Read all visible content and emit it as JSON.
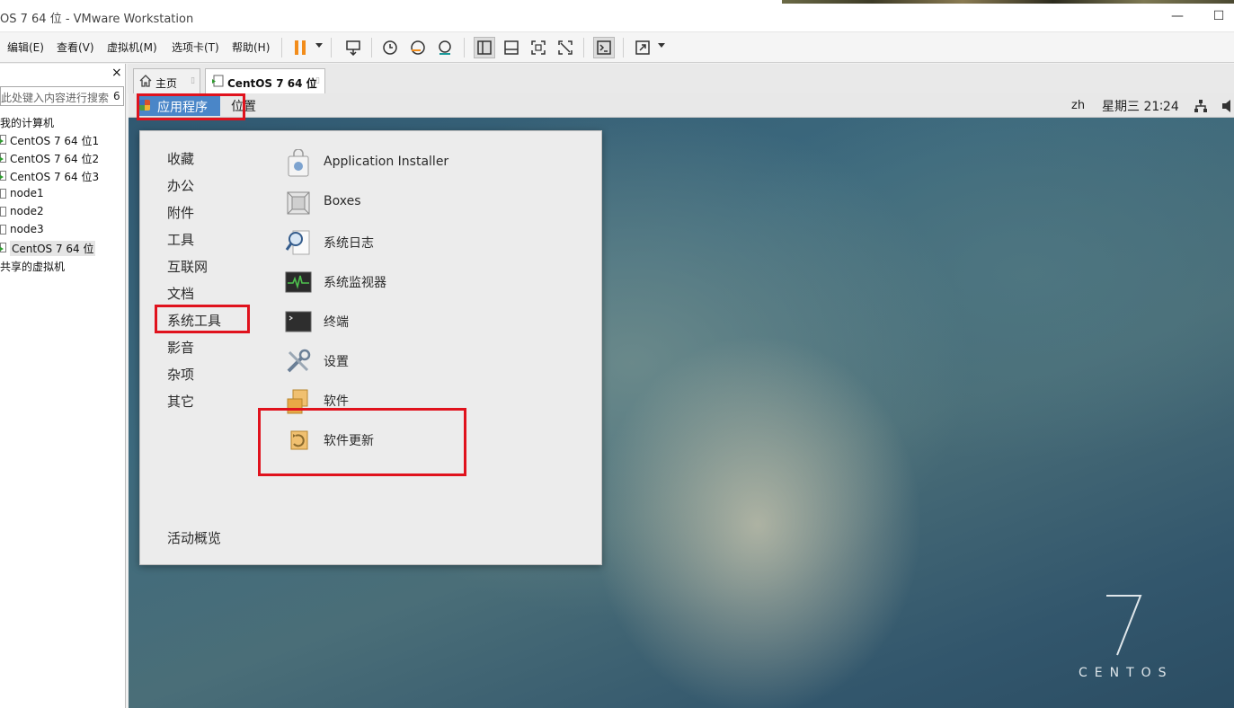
{
  "window": {
    "title": "OS 7 64 位 - VMware Workstation",
    "minimize_glyph": "—",
    "maximize_glyph": "☐"
  },
  "menubar": {
    "items": [
      "编辑(E)",
      "查看(V)",
      "虚拟机(M)",
      "选项卡(T)",
      "帮助(H)"
    ]
  },
  "toolbar": {
    "icons": [
      "pause-icon",
      "send-ctrl-alt-del-icon",
      "snapshot-icon",
      "revert-snapshot-icon",
      "snapshot-manager-icon",
      "show-library-icon",
      "thumbnail-bar-icon",
      "full-screen-icon",
      "unity-icon",
      "console-view-icon",
      "stretch-view-icon"
    ],
    "accent_color": "#f28c1a"
  },
  "sidebar": {
    "close_glyph": "×",
    "search_placeholder": "此处键入内容进行搜索",
    "search_caret": "6",
    "tree": [
      {
        "label": "我的计算机",
        "level": 0
      },
      {
        "label": "CentOS 7 64 位1",
        "level": 1,
        "running": true
      },
      {
        "label": "CentOS 7 64 位2",
        "level": 1,
        "running": true
      },
      {
        "label": "CentOS 7 64 位3",
        "level": 1,
        "running": true
      },
      {
        "label": "node1",
        "level": 1,
        "running": false
      },
      {
        "label": "node2",
        "level": 1,
        "running": false
      },
      {
        "label": "node3",
        "level": 1,
        "running": false
      },
      {
        "label": "CentOS 7 64 位",
        "level": 1,
        "running": true,
        "selected": true
      },
      {
        "label": "共享的虚拟机",
        "level": 0
      }
    ]
  },
  "tabs": [
    {
      "label": "主页",
      "icon": "home-icon",
      "active": false
    },
    {
      "label": "CentOS 7 64 位",
      "icon": "vm-running-icon",
      "active": true
    }
  ],
  "guest": {
    "topbar": {
      "applications": "应用程序",
      "places": "位置",
      "language": "zh",
      "clock": "星期三 21∶24"
    },
    "app_menu": {
      "categories": [
        "收藏",
        "办公",
        "附件",
        "工具",
        "互联网",
        "文档",
        "系统工具",
        "影音",
        "杂项",
        "其它"
      ],
      "selected_category": "系统工具",
      "apps": [
        {
          "label": "Application Installer",
          "icon": "application-installer-icon"
        },
        {
          "label": "Boxes",
          "icon": "boxes-icon"
        },
        {
          "label": "系统日志",
          "icon": "system-log-icon"
        },
        {
          "label": "系统监视器",
          "icon": "system-monitor-icon"
        },
        {
          "label": "终端",
          "icon": "terminal-icon"
        },
        {
          "label": "设置",
          "icon": "settings-icon"
        },
        {
          "label": "软件",
          "icon": "software-icon"
        },
        {
          "label": "软件更新",
          "icon": "software-update-icon"
        }
      ],
      "activities": "活动概览"
    },
    "wallpaper": {
      "logo_number": "7",
      "logo_text": "CENTOS"
    }
  },
  "annotation_color": "#e0121d"
}
